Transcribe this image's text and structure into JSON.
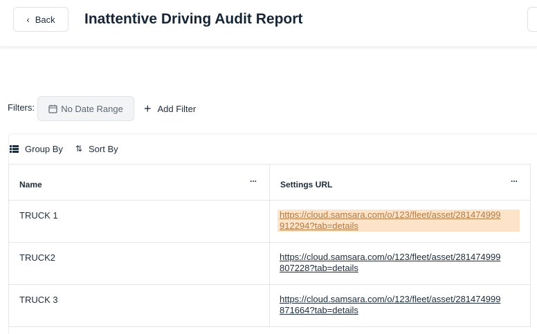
{
  "header": {
    "back_label": "Back",
    "title": "Inattentive Driving Audit Report"
  },
  "filters": {
    "label": "Filters:",
    "date_range": "No Date Range",
    "add_filter": "Add Filter"
  },
  "toolbar": {
    "group_by": "Group By",
    "sort_by": "Sort By"
  },
  "table": {
    "columns": [
      "Name",
      "Settings URL"
    ],
    "menu_icon": "...",
    "rows": [
      {
        "name": "TRUCK 1",
        "url_line1": "https://cloud.samsara.com/o/123/fleet/asset/281474999",
        "url_line2": "912294?tab=details",
        "highlighted": true
      },
      {
        "name": "TRUCK2",
        "url_line1": "https://cloud.samsara.com/o/123/fleet/asset/281474999",
        "url_line2": "807228?tab=details",
        "highlighted": false
      },
      {
        "name": "TRUCK 3",
        "url_line1": "https://cloud.samsara.com/o/123/fleet/asset/281474999",
        "url_line2": "871664?tab=details",
        "highlighted": false
      }
    ]
  },
  "colors": {
    "highlight": "#fde3c8",
    "text": "#1c2b3a"
  }
}
